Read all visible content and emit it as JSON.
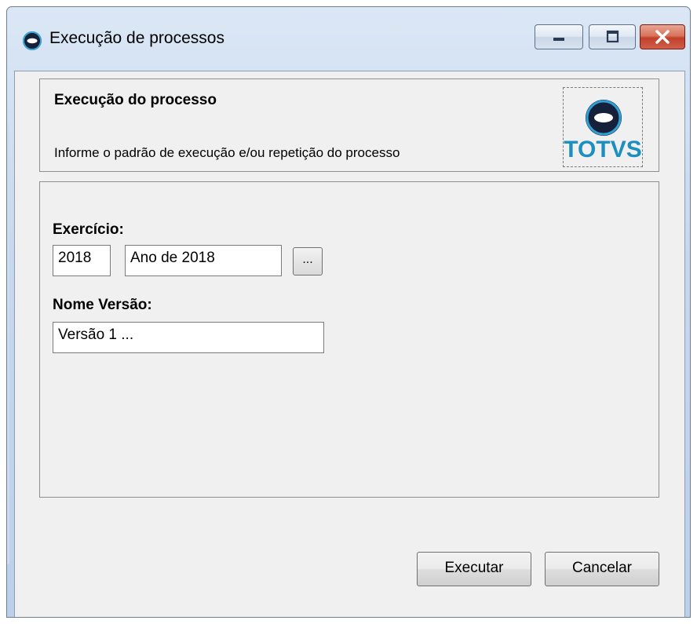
{
  "window": {
    "title": "Execução de processos",
    "icon": "totvs-logo-icon",
    "controls": {
      "minimize": "minimize-icon",
      "maximize": "maximize-icon",
      "close": "close-icon"
    }
  },
  "header": {
    "title": "Execução do processo",
    "subtitle": "Informe o padrão de execução e/ou repetição do processo",
    "logo_text": "TOTVS"
  },
  "form": {
    "exercicio_label": "Exercício:",
    "exercicio_year": "2018",
    "exercicio_description": "Ano de 2018",
    "browse_label": "...",
    "nome_versao_label": "Nome Versão:",
    "nome_versao_value": "Versão 1 ..."
  },
  "actions": {
    "execute_label": "Executar",
    "cancel_label": "Cancelar"
  },
  "colors": {
    "brand": "#1b8fbf",
    "background": "#f0f0f0"
  }
}
